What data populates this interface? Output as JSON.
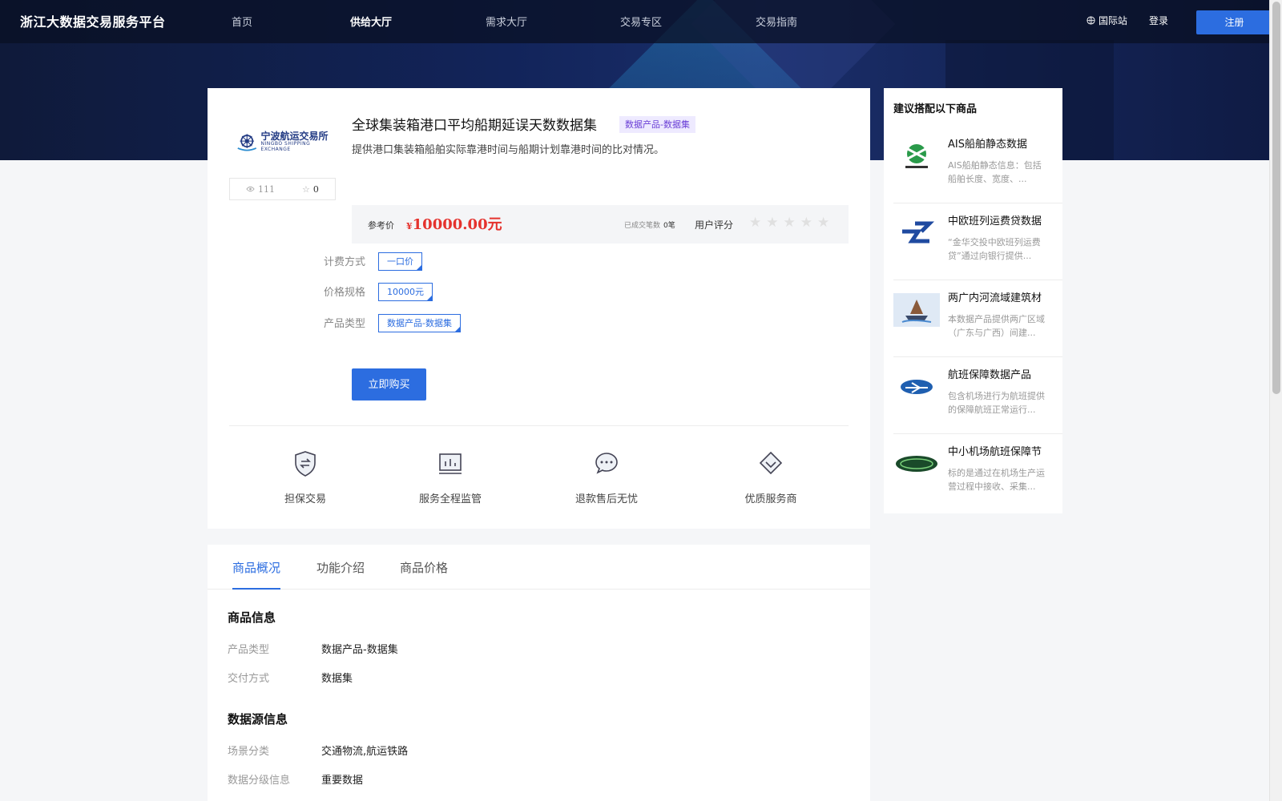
{
  "header": {
    "logo": "浙江大数据交易服务平台",
    "nav": [
      "首页",
      "供给大厅",
      "需求大厅",
      "交易专区",
      "交易指南"
    ],
    "active_nav": "供给大厅",
    "intl": "国际站",
    "login": "登录",
    "register": "注册"
  },
  "product": {
    "provider_name": "宁波航运交易所",
    "provider_sub": "NINGBO SHIPPING EXCHANGE",
    "views": "111",
    "favorites": "0",
    "title": "全球集装箱港口平均船期延误天数数据集",
    "tag": "数据产品-数据集",
    "description": "提供港口集装箱船舶实际靠港时间与船期计划靠港时间的比对情况。",
    "price_label": "参考价",
    "currency": "¥",
    "price": "10000.00元",
    "deals_label": "已成交笔数",
    "deals_value": "0笔",
    "rating_label": "用户评分",
    "rating_stars": 0,
    "options": [
      {
        "label": "计费方式",
        "value": "一口价"
      },
      {
        "label": "价格规格",
        "value": "10000元"
      },
      {
        "label": "产品类型",
        "value": "数据产品-数据集"
      }
    ],
    "buy_label": "立即购买",
    "features": [
      "担保交易",
      "服务全程监管",
      "退款售后无忧",
      "优质服务商"
    ]
  },
  "details": {
    "tabs": [
      "商品概况",
      "功能介绍",
      "商品价格"
    ],
    "active_tab": "商品概况",
    "section1": "商品信息",
    "rows1": [
      {
        "k": "产品类型",
        "v": "数据产品-数据集"
      },
      {
        "k": "交付方式",
        "v": "数据集"
      }
    ],
    "section2": "数据源信息",
    "rows2": [
      {
        "k": "场景分类",
        "v": "交通物流,航运铁路"
      },
      {
        "k": "数据分级信息",
        "v": "重要数据"
      }
    ]
  },
  "recommend": {
    "title": "建议搭配以下商品",
    "items": [
      {
        "name": "AIS船舶静态数据",
        "desc": "AIS船舶静态信息：包括船舶长度、宽度、..."
      },
      {
        "name": "中欧班列运费贷数据",
        "desc": "“金华交投中欧班列运费贷”通过向银行提供..."
      },
      {
        "name": "两广内河流域建筑材",
        "desc": "本数据产品提供两广区域（广东与广西）间建..."
      },
      {
        "name": "航班保障数据产品",
        "desc": "包含机场进行为航班提供的保障航班正常运行..."
      },
      {
        "name": "中小机场航班保障节",
        "desc": "标的是通过在机场生产运营过程中接收、采集..."
      }
    ]
  },
  "colors": {
    "accent": "#2c6de0",
    "price": "#e5322d",
    "tag_bg": "#eeeaff",
    "tag_text": "#6a3fd6"
  }
}
